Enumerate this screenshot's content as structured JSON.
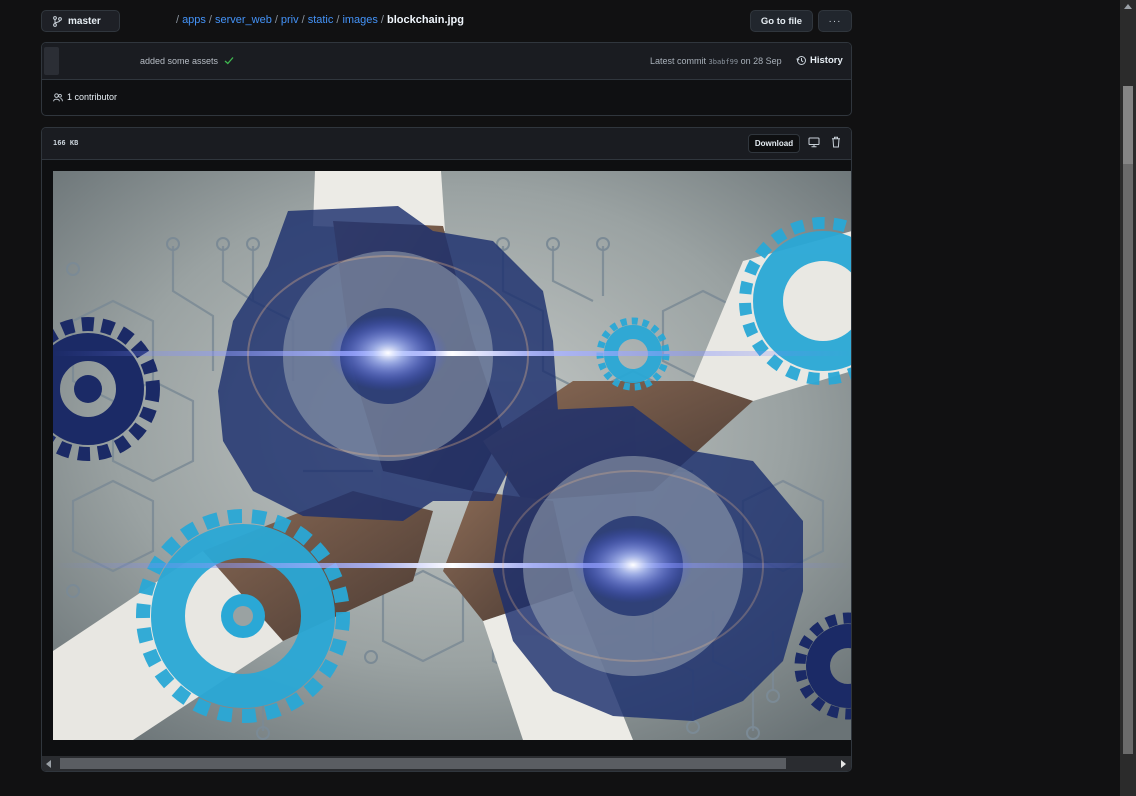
{
  "branch": {
    "label": "master"
  },
  "breadcrumb": {
    "links": [
      "apps",
      "server_web",
      "priv",
      "static",
      "images"
    ],
    "current": "blockchain.jpg"
  },
  "toolbar": {
    "goto_label": "Go to file",
    "more_label": "···"
  },
  "commit": {
    "message": "added some assets",
    "latest_prefix": "Latest commit",
    "sha": "3babf99",
    "date": "on 28 Sep",
    "history_label": "History"
  },
  "contributors": {
    "label": "1 contributor"
  },
  "file": {
    "size": "166 KB",
    "download_label": "Download"
  },
  "colors": {
    "link": "#4493f8",
    "check": "#3fb950",
    "gear_light": "#2aa8d6",
    "gear_dark": "#1b2a66"
  }
}
